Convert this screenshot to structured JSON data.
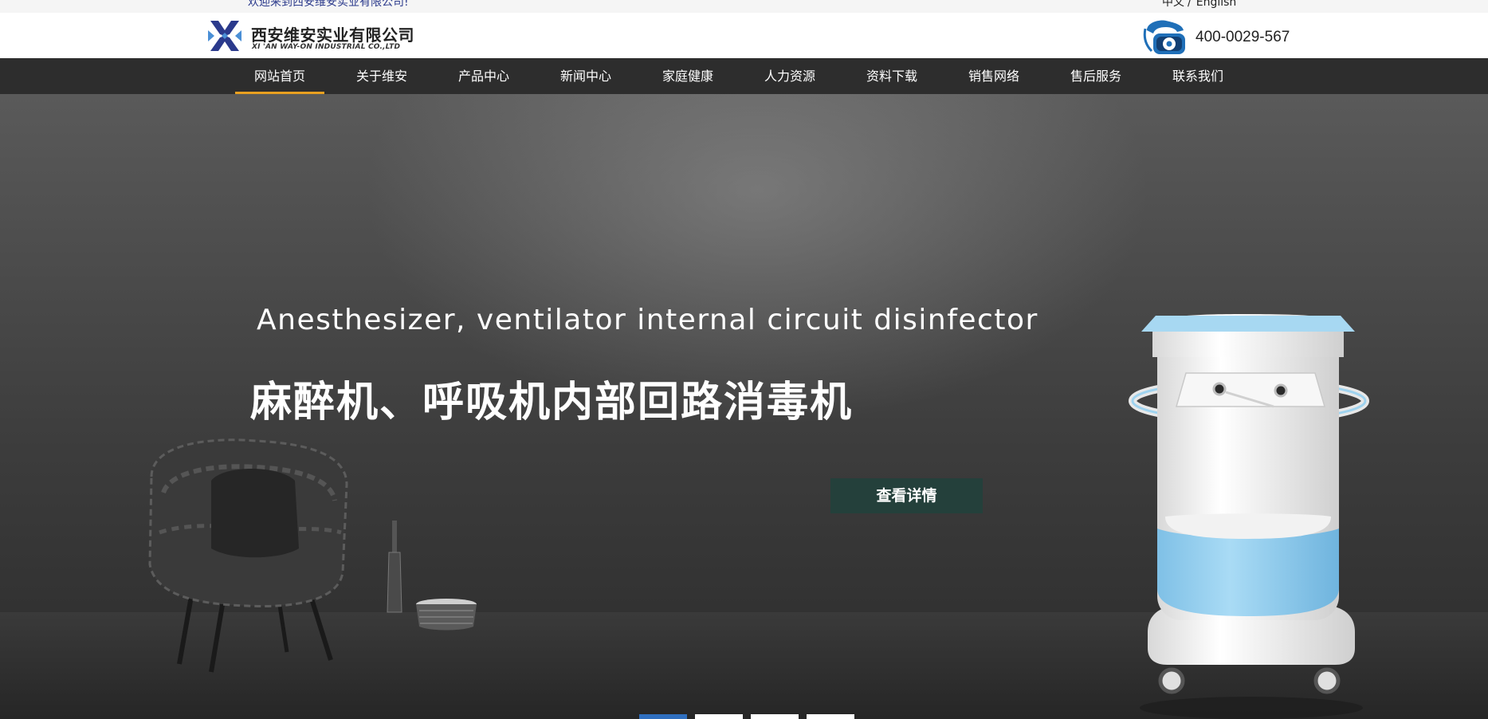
{
  "topbar": {
    "welcome": "欢迎来到西安维安实业有限公司!",
    "lang_cn": "中文",
    "lang_sep": "/",
    "lang_en": "English"
  },
  "header": {
    "logo_cn": "西安维安实业有限公司",
    "logo_en": "XI 'AN WAY-ON INDUSTRIAL CO.,LTD",
    "phone": "400-0029-567"
  },
  "nav": {
    "items": [
      {
        "label": "网站首页",
        "active": true
      },
      {
        "label": "关于维安"
      },
      {
        "label": "产品中心"
      },
      {
        "label": "新闻中心"
      },
      {
        "label": "家庭健康"
      },
      {
        "label": "人力资源"
      },
      {
        "label": "资料下载"
      },
      {
        "label": "销售网络"
      },
      {
        "label": "售后服务"
      },
      {
        "label": "联系我们"
      }
    ]
  },
  "hero": {
    "subtitle": "Anesthesizer, ventilator internal circuit disinfector",
    "title": "麻醉机、呼吸机内部回路消毒机",
    "button": "查看详情",
    "slides_total": 4,
    "slide_active": 1
  },
  "colors": {
    "nav_bg": "#2d2d2d",
    "nav_active_underline": "#e8a020",
    "button_bg": "#24403b",
    "logo_blue": "#2b3a8c",
    "device_blue": "#8ccbeb",
    "slider_active": "#2f6fbf"
  },
  "icons": [
    "logo-mark-icon",
    "telephone-icon"
  ]
}
